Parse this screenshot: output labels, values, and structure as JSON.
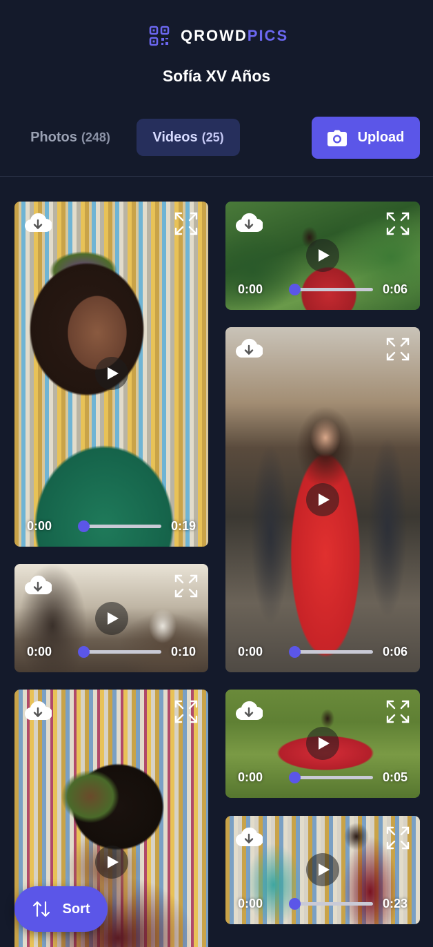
{
  "brand": {
    "name_part1": "QROWD",
    "name_part2": "PICS",
    "accent_color": "#5b56e8"
  },
  "event": {
    "title": "Sofía XV Años"
  },
  "tabs": [
    {
      "label": "Photos",
      "count": "(248)",
      "active": false
    },
    {
      "label": "Videos",
      "count": "(25)",
      "active": true
    }
  ],
  "upload": {
    "label": "Upload",
    "icon": "camera-icon"
  },
  "videos": [
    {
      "current": "0:00",
      "duration": "0:19",
      "progress": 0,
      "scene": "party-dancer-fringe"
    },
    {
      "current": "0:00",
      "duration": "0:06",
      "progress": 0,
      "scene": "quinceanera-garden-swing"
    },
    {
      "current": "0:00",
      "duration": "0:06",
      "progress": 0,
      "scene": "mariachi-courtyard"
    },
    {
      "current": "0:00",
      "duration": "0:10",
      "progress": 0,
      "scene": "party-table-cake"
    },
    {
      "current": "0:00",
      "duration": "0:05",
      "progress": 0,
      "scene": "red-dress-on-lawn"
    },
    {
      "current": "",
      "duration": "",
      "progress": 0,
      "scene": "masked-dancer-fringe"
    },
    {
      "current": "0:00",
      "duration": "0:23",
      "progress": 0,
      "scene": "dancers-red-dress"
    }
  ],
  "sort": {
    "label": "Sort",
    "icon": "sort-arrows-icon"
  }
}
